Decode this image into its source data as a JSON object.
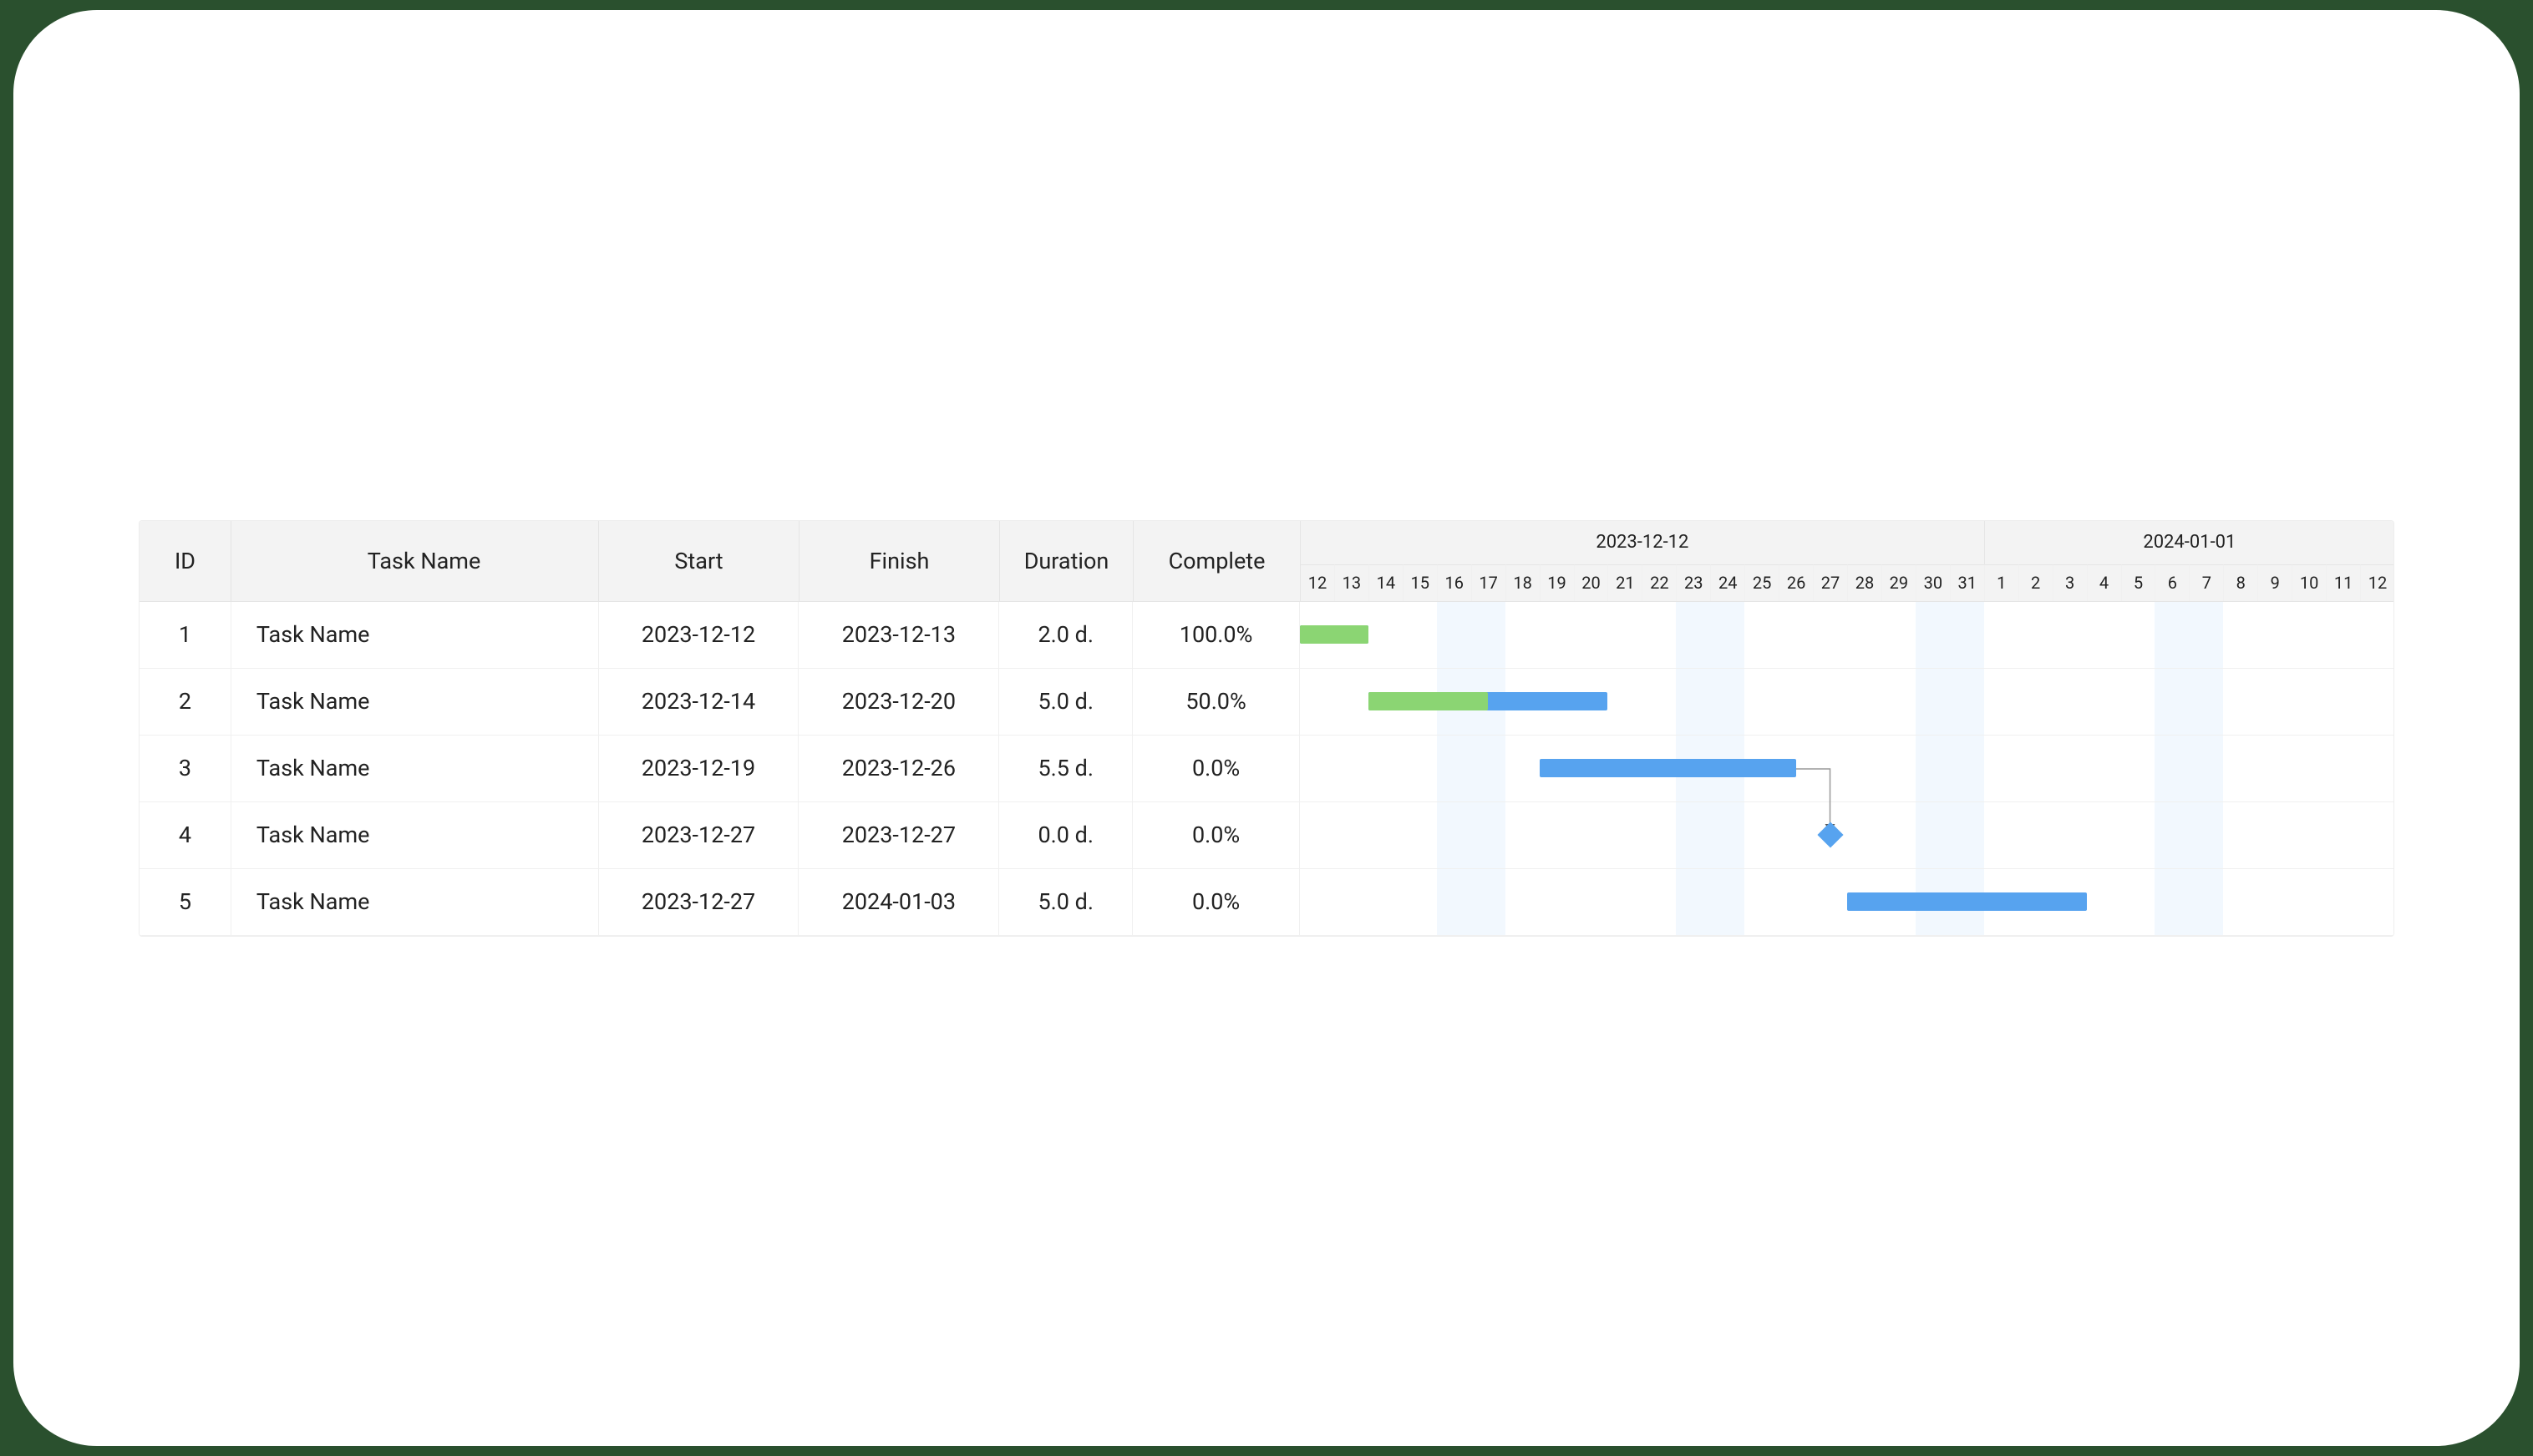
{
  "columns": {
    "id": "ID",
    "name": "Task Name",
    "start": "Start",
    "finish": "Finish",
    "duration": "Duration",
    "complete": "Complete"
  },
  "timeline": {
    "groups": [
      {
        "label": "2023-12-12",
        "start_day": 0,
        "span": 20
      },
      {
        "label": "2024-01-01",
        "start_day": 20,
        "span": 12
      }
    ],
    "start_date": "2023-12-12",
    "days": [
      "12",
      "13",
      "14",
      "15",
      "16",
      "17",
      "18",
      "19",
      "20",
      "21",
      "22",
      "23",
      "24",
      "25",
      "26",
      "27",
      "28",
      "29",
      "30",
      "31",
      "1",
      "2",
      "3",
      "4",
      "5",
      "6",
      "7",
      "8",
      "9",
      "10",
      "11",
      "12"
    ],
    "weekend_day_indices": [
      4,
      5,
      11,
      12,
      18,
      19,
      25,
      26
    ]
  },
  "tasks": [
    {
      "id": "1",
      "name": "Task Name",
      "start": "2023-12-12",
      "finish": "2023-12-13",
      "duration": "2.0 d.",
      "complete": "100.0%",
      "bar_start": 0,
      "bar_span": 2,
      "progress": 1.0,
      "type": "task"
    },
    {
      "id": "2",
      "name": "Task Name",
      "start": "2023-12-14",
      "finish": "2023-12-20",
      "duration": "5.0 d.",
      "complete": "50.0%",
      "bar_start": 2,
      "bar_span": 7,
      "progress": 0.5,
      "type": "task"
    },
    {
      "id": "3",
      "name": "Task Name",
      "start": "2023-12-19",
      "finish": "2023-12-26",
      "duration": "5.5 d.",
      "complete": "0.0%",
      "bar_start": 7,
      "bar_span": 7.5,
      "progress": 0.0,
      "type": "task",
      "link_to_row": 3,
      "link_to_day": 15.5
    },
    {
      "id": "4",
      "name": "Task Name",
      "start": "2023-12-27",
      "finish": "2023-12-27",
      "duration": "0.0 d.",
      "complete": "0.0%",
      "bar_start": 15.5,
      "bar_span": 0,
      "progress": 0.0,
      "type": "milestone"
    },
    {
      "id": "5",
      "name": "Task Name",
      "start": "2023-12-27",
      "finish": "2024-01-03",
      "duration": "5.0 d.",
      "complete": "0.0%",
      "bar_start": 16,
      "bar_span": 7,
      "progress": 0.0,
      "type": "task"
    }
  ],
  "chart_data": {
    "type": "gantt",
    "title": "",
    "time_range": [
      "2023-12-12",
      "2024-01-12"
    ],
    "series": [
      {
        "id": 1,
        "name": "Task Name",
        "start": "2023-12-12",
        "finish": "2023-12-13",
        "duration_days": 2.0,
        "complete_pct": 100.0,
        "milestone": false
      },
      {
        "id": 2,
        "name": "Task Name",
        "start": "2023-12-14",
        "finish": "2023-12-20",
        "duration_days": 5.0,
        "complete_pct": 50.0,
        "milestone": false
      },
      {
        "id": 3,
        "name": "Task Name",
        "start": "2023-12-19",
        "finish": "2023-12-26",
        "duration_days": 5.5,
        "complete_pct": 0.0,
        "milestone": false,
        "successor": 4
      },
      {
        "id": 4,
        "name": "Task Name",
        "start": "2023-12-27",
        "finish": "2023-12-27",
        "duration_days": 0.0,
        "complete_pct": 0.0,
        "milestone": true
      },
      {
        "id": 5,
        "name": "Task Name",
        "start": "2023-12-27",
        "finish": "2024-01-03",
        "duration_days": 5.0,
        "complete_pct": 0.0,
        "milestone": false
      }
    ]
  }
}
